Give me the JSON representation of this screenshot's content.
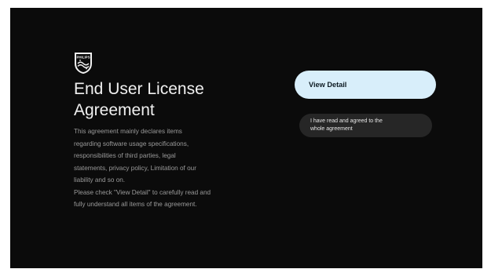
{
  "brand": {
    "logo_icon": "philips-shield-logo-icon",
    "logo_text": "PHILIPS"
  },
  "agreement": {
    "title_lines": [
      "End User License",
      "Agreement"
    ],
    "description_lines": [
      "This agreement mainly declares items",
      "regarding software usage specifications,",
      "responsibilities of third parties, legal",
      "statements, privacy policy, Limitation of our",
      "liability and so on.",
      "Please check \"View Detail\" to carefully read and",
      "fully understand all items of the agreement."
    ]
  },
  "actions": {
    "view_detail_label": "View Detail",
    "agree_label_lines": [
      "I have read and agreed to the",
      "whole agreement"
    ]
  },
  "colors": {
    "background": "#0b0b0b",
    "focused_button": "#d8eefa",
    "secondary_button": "#262626"
  }
}
